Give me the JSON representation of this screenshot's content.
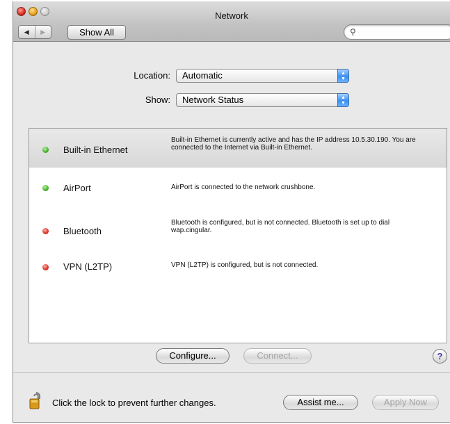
{
  "window": {
    "title": "Network"
  },
  "toolbar": {
    "back_icon": "back-arrow-icon",
    "forward_icon": "forward-arrow-icon",
    "show_all_label": "Show All",
    "search_icon": "search-icon",
    "search_value": ""
  },
  "location": {
    "label": "Location:",
    "value": "Automatic"
  },
  "show": {
    "label": "Show:",
    "value": "Network Status"
  },
  "services": [
    {
      "name": "Built-in Ethernet",
      "status": "green",
      "selected": true,
      "description": "Built-in Ethernet is currently active and has the IP address 10.5.30.190. You are connected to the Internet via Built-in Ethernet."
    },
    {
      "name": "AirPort",
      "status": "green",
      "selected": false,
      "description": "AirPort is connected to the network crushbone."
    },
    {
      "name": "Bluetooth",
      "status": "red",
      "selected": false,
      "description": "Bluetooth is configured, but is not connected. Bluetooth is set up to dial wap.cingular."
    },
    {
      "name": "VPN (L2TP)",
      "status": "red",
      "selected": false,
      "description": "VPN (L2TP) is configured, but is not connected."
    }
  ],
  "actions": {
    "configure_label": "Configure...",
    "connect_label": "Connect...",
    "help_label": "?"
  },
  "footer": {
    "lock_text": "Click the lock to prevent further changes.",
    "assist_label": "Assist me...",
    "apply_label": "Apply Now"
  },
  "colors": {
    "status_green": "#3cab22",
    "status_red": "#d8261b",
    "popup_blue": "#3a8ef0"
  }
}
